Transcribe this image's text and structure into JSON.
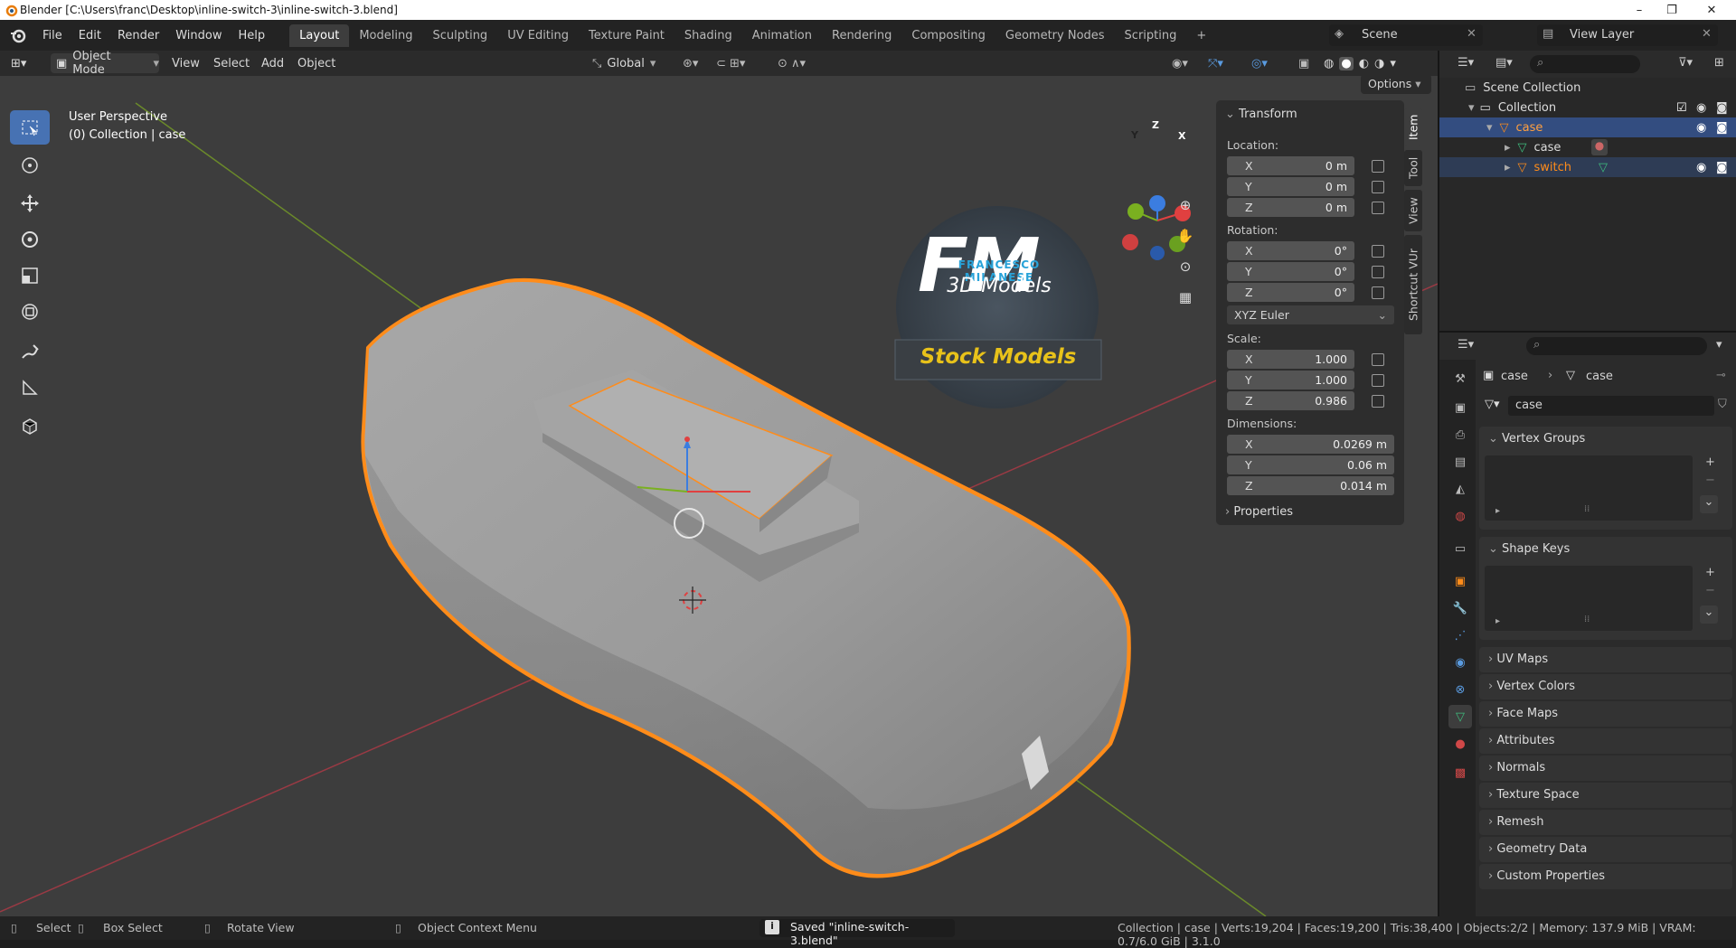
{
  "window": {
    "title": "Blender [C:\\Users\\franc\\Desktop\\inline-switch-3\\inline-switch-3.blend]",
    "minimize": "–",
    "maximize": "❐",
    "close": "✕"
  },
  "menu": [
    "File",
    "Edit",
    "Render",
    "Window",
    "Help"
  ],
  "workspaces": [
    "Layout",
    "Modeling",
    "Sculpting",
    "UV Editing",
    "Texture Paint",
    "Shading",
    "Animation",
    "Rendering",
    "Compositing",
    "Geometry Nodes",
    "Scripting",
    "+"
  ],
  "active_workspace": "Layout",
  "scene": {
    "label": "Scene",
    "view_layer": "View Layer"
  },
  "header": {
    "mode": "Object Mode",
    "view": "View",
    "select": "Select",
    "add": "Add",
    "object": "Object",
    "orientation": "Global",
    "options": "Options"
  },
  "viewport": {
    "perspective": "User Perspective",
    "collection_info": "(0) Collection | case"
  },
  "gizmo": {
    "x": "X",
    "y": "Y",
    "z": "Z"
  },
  "watermark": {
    "initials": "FM",
    "name": "FRANCESCO MILANESE",
    "subtitle": "3D Models",
    "banner": "Stock Models"
  },
  "npanel": {
    "title": "Transform",
    "location_label": "Location:",
    "location": [
      {
        "axis": "X",
        "value": "0 m"
      },
      {
        "axis": "Y",
        "value": "0 m"
      },
      {
        "axis": "Z",
        "value": "0 m"
      }
    ],
    "rotation_label": "Rotation:",
    "rotation": [
      {
        "axis": "X",
        "value": "0°"
      },
      {
        "axis": "Y",
        "value": "0°"
      },
      {
        "axis": "Z",
        "value": "0°"
      }
    ],
    "rotation_mode": "XYZ Euler",
    "scale_label": "Scale:",
    "scale": [
      {
        "axis": "X",
        "value": "1.000"
      },
      {
        "axis": "Y",
        "value": "1.000"
      },
      {
        "axis": "Z",
        "value": "0.986"
      }
    ],
    "dimensions_label": "Dimensions:",
    "dimensions": [
      {
        "axis": "X",
        "value": "0.0269 m"
      },
      {
        "axis": "Y",
        "value": "0.06 m"
      },
      {
        "axis": "Z",
        "value": "0.014 m"
      }
    ],
    "properties": "Properties",
    "tabs": [
      "Item",
      "Tool",
      "View",
      "Shortcut VUr"
    ]
  },
  "outliner": {
    "scene_collection": "Scene Collection",
    "collection": "Collection",
    "items": [
      "case",
      "case",
      "switch"
    ]
  },
  "properties": {
    "breadcrumb_object": "case",
    "breadcrumb_mesh": "case",
    "mesh_name": "case",
    "panels_open": [
      "Vertex Groups",
      "Shape Keys"
    ],
    "panels_closed": [
      "UV Maps",
      "Vertex Colors",
      "Face Maps",
      "Attributes",
      "Normals",
      "Texture Space",
      "Remesh",
      "Geometry Data",
      "Custom Properties"
    ]
  },
  "status": {
    "select": "Select",
    "box_select": "Box Select",
    "rotate_view": "Rotate View",
    "context_menu": "Object Context Menu",
    "saved": "Saved \"inline-switch-3.blend\"",
    "stats": "Collection | case | Verts:19,204 | Faces:19,200 | Tris:38,400 | Objects:2/2 | Memory: 137.9 MiB | VRAM: 0.7/6.0 GiB | 3.1.0"
  },
  "colors": {
    "accent": "#4772b3",
    "selection": "#ff8c1a",
    "fm_blue": "#29a3d9",
    "banner_yellow": "#e8c21a"
  }
}
